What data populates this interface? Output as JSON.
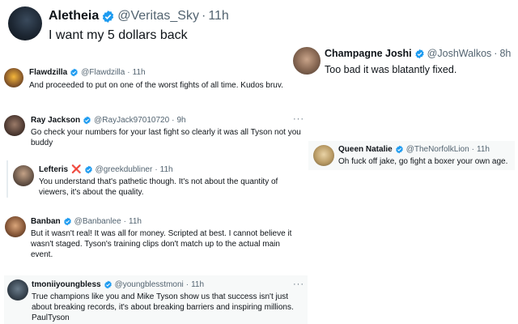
{
  "tweets": [
    {
      "name": "Aletheia",
      "handle": "@Veritas_Sky",
      "time": "11h",
      "text": "I want my 5 dollars back"
    },
    {
      "name": "Champagne Joshi",
      "handle": "@JoshWalkos",
      "time": "8h",
      "text": "Too bad it was blatantly fixed."
    },
    {
      "name": "Flawdzilla",
      "handle": "@Flawdzilla",
      "time": "11h",
      "text": "And proceeded to put on one of the worst fights of all time. Kudos bruv."
    },
    {
      "name": "Ray Jackson",
      "handle": "@RayJack97010720",
      "time": "9h",
      "lines": [
        "Go check your numbers for your last fight so clearly it was all Tyson not you",
        "buddy"
      ]
    },
    {
      "name": "Queen Natalie",
      "handle": "@TheNorfolkLion",
      "time": "11h",
      "text": "Oh fuck off jake, go fight a boxer your own age."
    },
    {
      "name": "Lefteris",
      "badge": "❌",
      "handle": "@greekdubliner",
      "time": "11h",
      "lines": [
        "You understand that's pathetic though. It's not about the quantity of",
        "viewers, it's about the quality."
      ]
    },
    {
      "name": "Banban",
      "handle": "@Banbanlee",
      "time": "11h",
      "lines": [
        "But it wasn't real! It was all for money. Scripted at best. I cannot believe it",
        "wasn't staged. Tyson's training clips don't match up to the actual main",
        "event."
      ]
    },
    {
      "name": "tmoniiyoungbless",
      "handle": "@youngblesstmoni",
      "time": "11h",
      "lines": [
        "True champions like you and Mike Tyson show us that success isn't just",
        "about breaking records, it's about breaking barriers and inspiring millions.",
        "PaulTyson"
      ]
    }
  ],
  "more_label": "···",
  "colors": {
    "verified": "#1d9bf0",
    "secondary_text": "#536471",
    "x_badge": "#d9272e"
  }
}
